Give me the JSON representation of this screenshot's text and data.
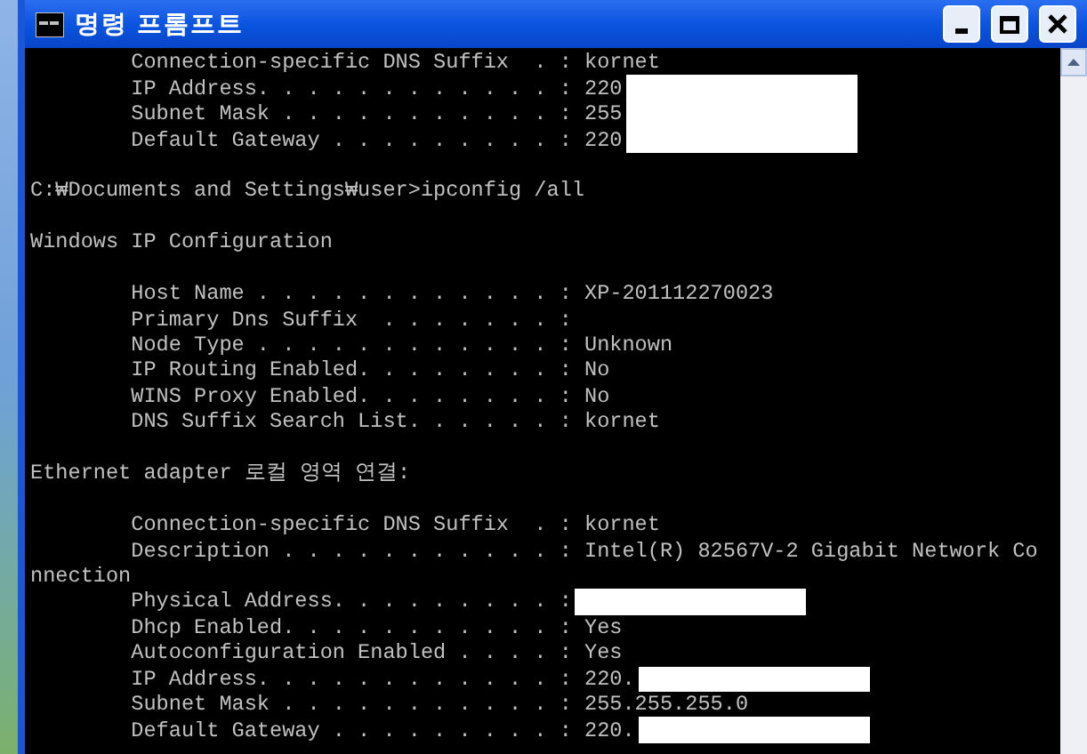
{
  "window": {
    "title": "명령 프롬프트"
  },
  "console_lines": [
    {
      "kind": "text",
      "text": "        Connection-specific DNS Suffix  . : kornet",
      "redacted": false
    },
    {
      "kind": "text",
      "text": "        IP Address. . . . . . . . . . . . : 220",
      "redacted": true
    },
    {
      "kind": "text",
      "text": "        Subnet Mask . . . . . . . . . . . : 255",
      "redacted": true
    },
    {
      "kind": "text",
      "text": "        Default Gateway . . . . . . . . . : 220",
      "redacted": true
    },
    {
      "kind": "blank"
    },
    {
      "kind": "text",
      "text": "C:₩Documents and Settings₩user>ipconfig /all",
      "redacted": false
    },
    {
      "kind": "blank"
    },
    {
      "kind": "text",
      "text": "Windows IP Configuration",
      "redacted": false
    },
    {
      "kind": "blank"
    },
    {
      "kind": "text",
      "text": "        Host Name . . . . . . . . . . . . : XP-201112270023",
      "redacted": false
    },
    {
      "kind": "text",
      "text": "        Primary Dns Suffix  . . . . . . . :",
      "redacted": false
    },
    {
      "kind": "text",
      "text": "        Node Type . . . . . . . . . . . . : Unknown",
      "redacted": false
    },
    {
      "kind": "text",
      "text": "        IP Routing Enabled. . . . . . . . : No",
      "redacted": false
    },
    {
      "kind": "text",
      "text": "        WINS Proxy Enabled. . . . . . . . : No",
      "redacted": false
    },
    {
      "kind": "text",
      "text": "        DNS Suffix Search List. . . . . . : kornet",
      "redacted": false
    },
    {
      "kind": "blank"
    },
    {
      "kind": "text",
      "text": "Ethernet adapter 로컬 영역 연결:",
      "redacted": false
    },
    {
      "kind": "blank"
    },
    {
      "kind": "text",
      "text": "        Connection-specific DNS Suffix  . : kornet",
      "redacted": false
    },
    {
      "kind": "text",
      "text": "        Description . . . . . . . . . . . : Intel(R) 82567V-2 Gigabit Network Co",
      "redacted": false
    },
    {
      "kind": "text",
      "text": "nnection",
      "redacted": false
    },
    {
      "kind": "text",
      "text": "        Physical Address. . . . . . . . . :",
      "redacted": true
    },
    {
      "kind": "text",
      "text": "        Dhcp Enabled. . . . . . . . . . . : Yes",
      "redacted": false
    },
    {
      "kind": "text",
      "text": "        Autoconfiguration Enabled . . . . : Yes",
      "redacted": false
    },
    {
      "kind": "text",
      "text": "        IP Address. . . . . . . . . . . . : 220.",
      "redacted": true
    },
    {
      "kind": "text",
      "text": "        Subnet Mask . . . . . . . . . . . : 255.255.255.0",
      "redacted": false
    },
    {
      "kind": "text",
      "text": "        Default Gateway . . . . . . . . . : 220.",
      "redacted": true
    }
  ]
}
